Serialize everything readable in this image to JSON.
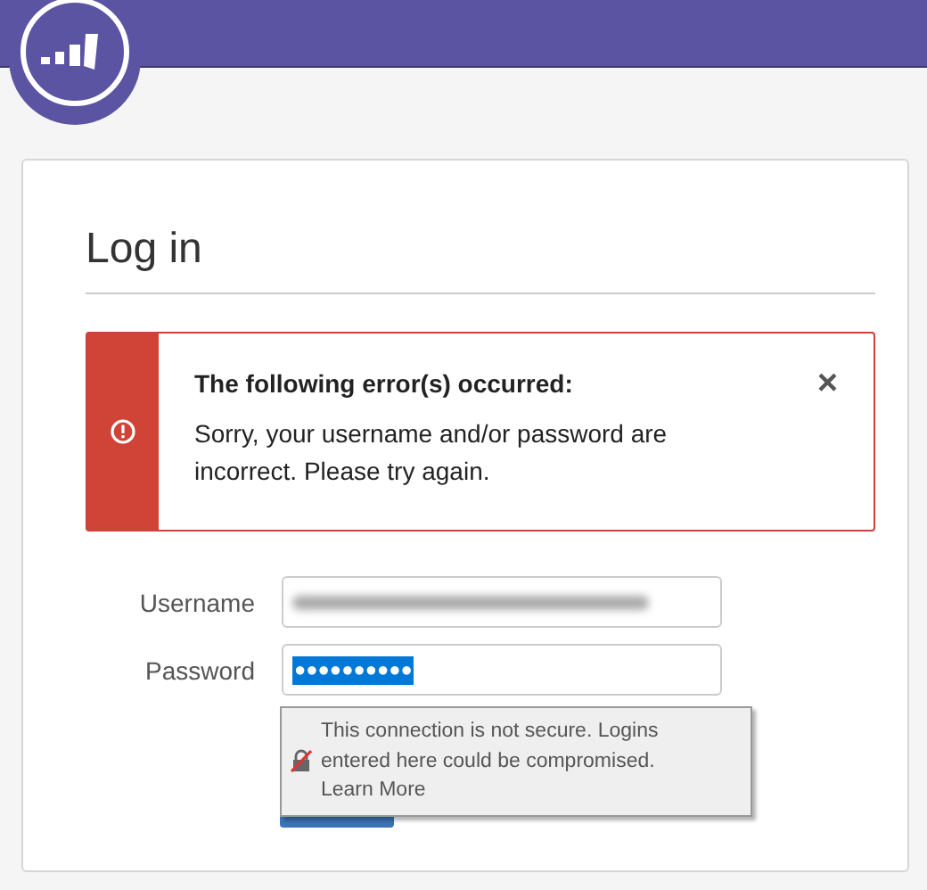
{
  "page": {
    "title": "Log in"
  },
  "alert": {
    "kind": "error",
    "heading": "The following error(s) occurred:",
    "message": "Sorry, your username and/or password are incorrect. Please try again.",
    "close_label": "×"
  },
  "fields": [
    {
      "kind": "text",
      "label": "Username",
      "blurred": true
    },
    {
      "kind": "password",
      "label": "Password",
      "value": "●●●●●●●●●●",
      "selected": true
    }
  ],
  "tooltip": {
    "message": "This connection is not secure. Logins entered here could be compromised.",
    "link": "Learn More"
  }
}
